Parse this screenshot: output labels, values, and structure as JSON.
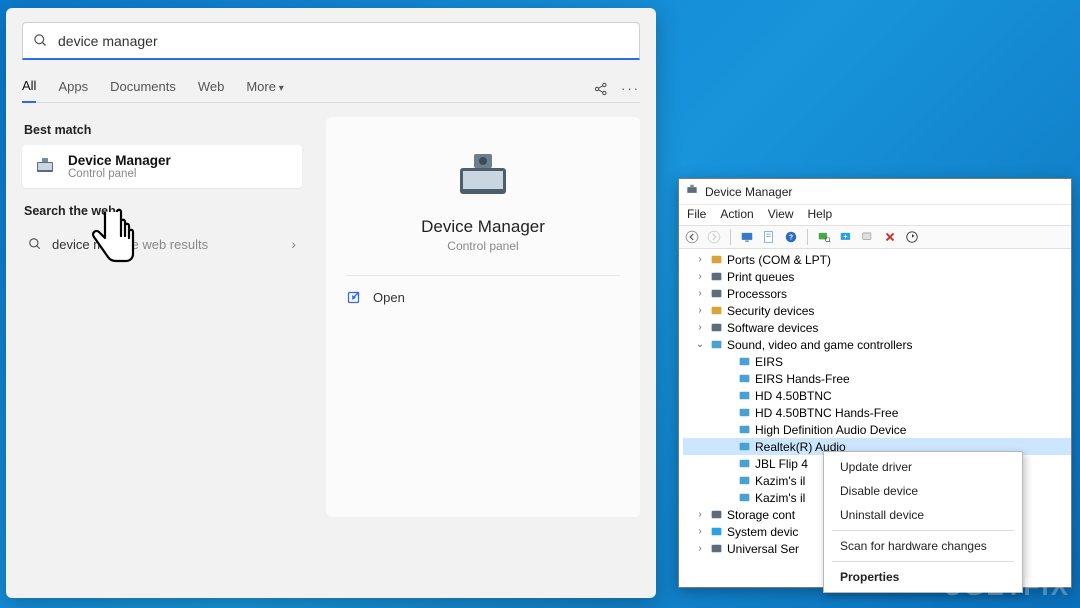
{
  "search": {
    "query": "device manager",
    "tabs": [
      "All",
      "Apps",
      "Documents",
      "Web",
      "More"
    ],
    "best_match_label": "Best match",
    "best_match": {
      "title": "Device Manager",
      "subtitle": "Control panel"
    },
    "search_web_label": "Search the web",
    "web_result": {
      "prefix": "device m",
      "suffix": "See web results"
    },
    "detail": {
      "title": "Device Manager",
      "subtitle": "Control panel",
      "open_label": "Open"
    }
  },
  "dm": {
    "title": "Device Manager",
    "menu": [
      "File",
      "Action",
      "View",
      "Help"
    ],
    "categories": [
      {
        "label": "Ports (COM & LPT)",
        "icon": "port"
      },
      {
        "label": "Print queues",
        "icon": "printer"
      },
      {
        "label": "Processors",
        "icon": "cpu"
      },
      {
        "label": "Security devices",
        "icon": "security"
      },
      {
        "label": "Software devices",
        "icon": "software"
      }
    ],
    "expanded": {
      "label": "Sound, video and game controllers",
      "items": [
        "EIRS",
        "EIRS Hands-Free",
        "HD 4.50BTNC",
        "HD 4.50BTNC Hands-Free",
        "High Definition Audio Device",
        "Realtek(R) Audio",
        "JBL Flip 4",
        "Kazim's il",
        "Kazim's il"
      ],
      "selected_index": 5
    },
    "after": [
      {
        "label": "Storage cont",
        "icon": "storage"
      },
      {
        "label": "System devic",
        "icon": "system"
      },
      {
        "label": "Universal Ser",
        "icon": "usb"
      }
    ],
    "context_menu": [
      "Update driver",
      "Disable device",
      "Uninstall device",
      "Scan for hardware changes",
      "Properties"
    ]
  },
  "watermark": "UGETFIX"
}
